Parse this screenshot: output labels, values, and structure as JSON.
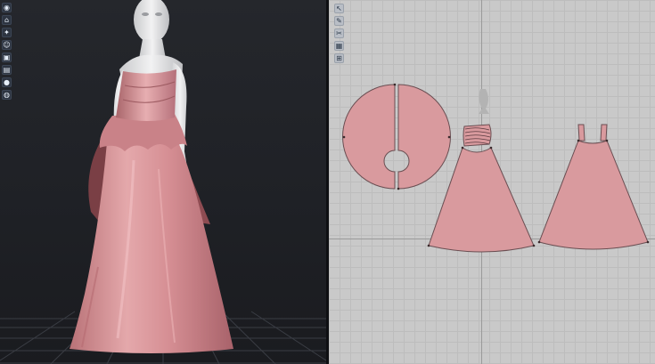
{
  "window": {
    "title": ""
  },
  "viewport3d": {
    "background": "#1f2126",
    "garment_color": "#d99a9e",
    "avatar_color": "#e9e9ea"
  },
  "viewport2d": {
    "background": "#c9c9c9",
    "pattern_fill": "#d99a9e",
    "pattern_stroke": "#6a4e52"
  },
  "toolbar3d": {
    "items": [
      {
        "icon": "globe-icon",
        "glyph": "◉"
      },
      {
        "icon": "shirt-icon",
        "glyph": "⌂"
      },
      {
        "icon": "avatar-pose-icon",
        "glyph": "✦"
      },
      {
        "icon": "person-icon",
        "glyph": "☺"
      },
      {
        "icon": "cube-icon",
        "glyph": "▣"
      },
      {
        "icon": "layer-icon",
        "glyph": "▤"
      },
      {
        "icon": "light-icon",
        "glyph": "●"
      },
      {
        "icon": "sphere-icon",
        "glyph": "◍"
      }
    ]
  },
  "toolbar2d": {
    "items": [
      {
        "icon": "transform-pattern-icon",
        "glyph": "↖"
      },
      {
        "icon": "edit-point-icon",
        "glyph": "✎"
      },
      {
        "icon": "sewing-icon",
        "glyph": "✂"
      },
      {
        "icon": "texture-icon",
        "glyph": "▦"
      },
      {
        "icon": "grid-snap-icon",
        "glyph": "⊞"
      }
    ]
  }
}
